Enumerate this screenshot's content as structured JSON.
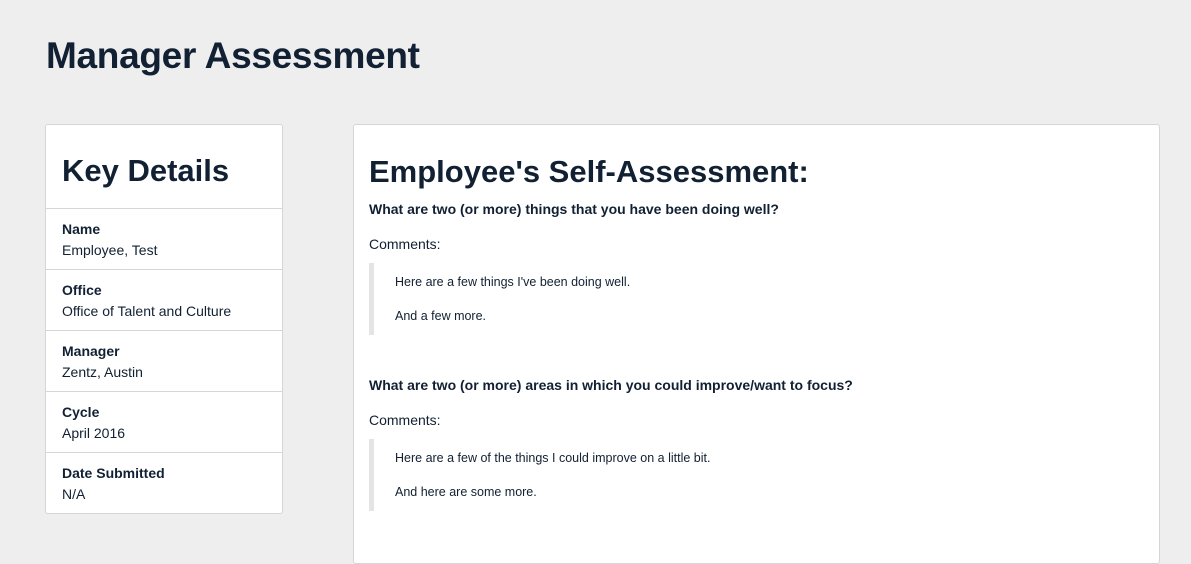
{
  "page": {
    "title": "Manager Assessment"
  },
  "key_details": {
    "title": "Key Details",
    "rows": [
      {
        "label": "Name",
        "value": "Employee, Test"
      },
      {
        "label": "Office",
        "value": "Office of Talent and Culture"
      },
      {
        "label": "Manager",
        "value": "Zentz, Austin"
      },
      {
        "label": "Cycle",
        "value": "April 2016"
      },
      {
        "label": "Date Submitted",
        "value": "N/A"
      }
    ]
  },
  "self_assessment": {
    "title": "Employee's Self-Assessment:",
    "questions": [
      {
        "question": "What are two (or more) things that you have been doing well?",
        "comments_label": "Comments:",
        "answer": [
          "Here are a few things I've been doing well.",
          "And a few more."
        ]
      },
      {
        "question": "What are two (or more) areas in which you could improve/want to focus?",
        "comments_label": "Comments:",
        "answer": [
          "Here are a few of the things I could improve on a little bit.",
          "And here are some more."
        ]
      }
    ]
  }
}
